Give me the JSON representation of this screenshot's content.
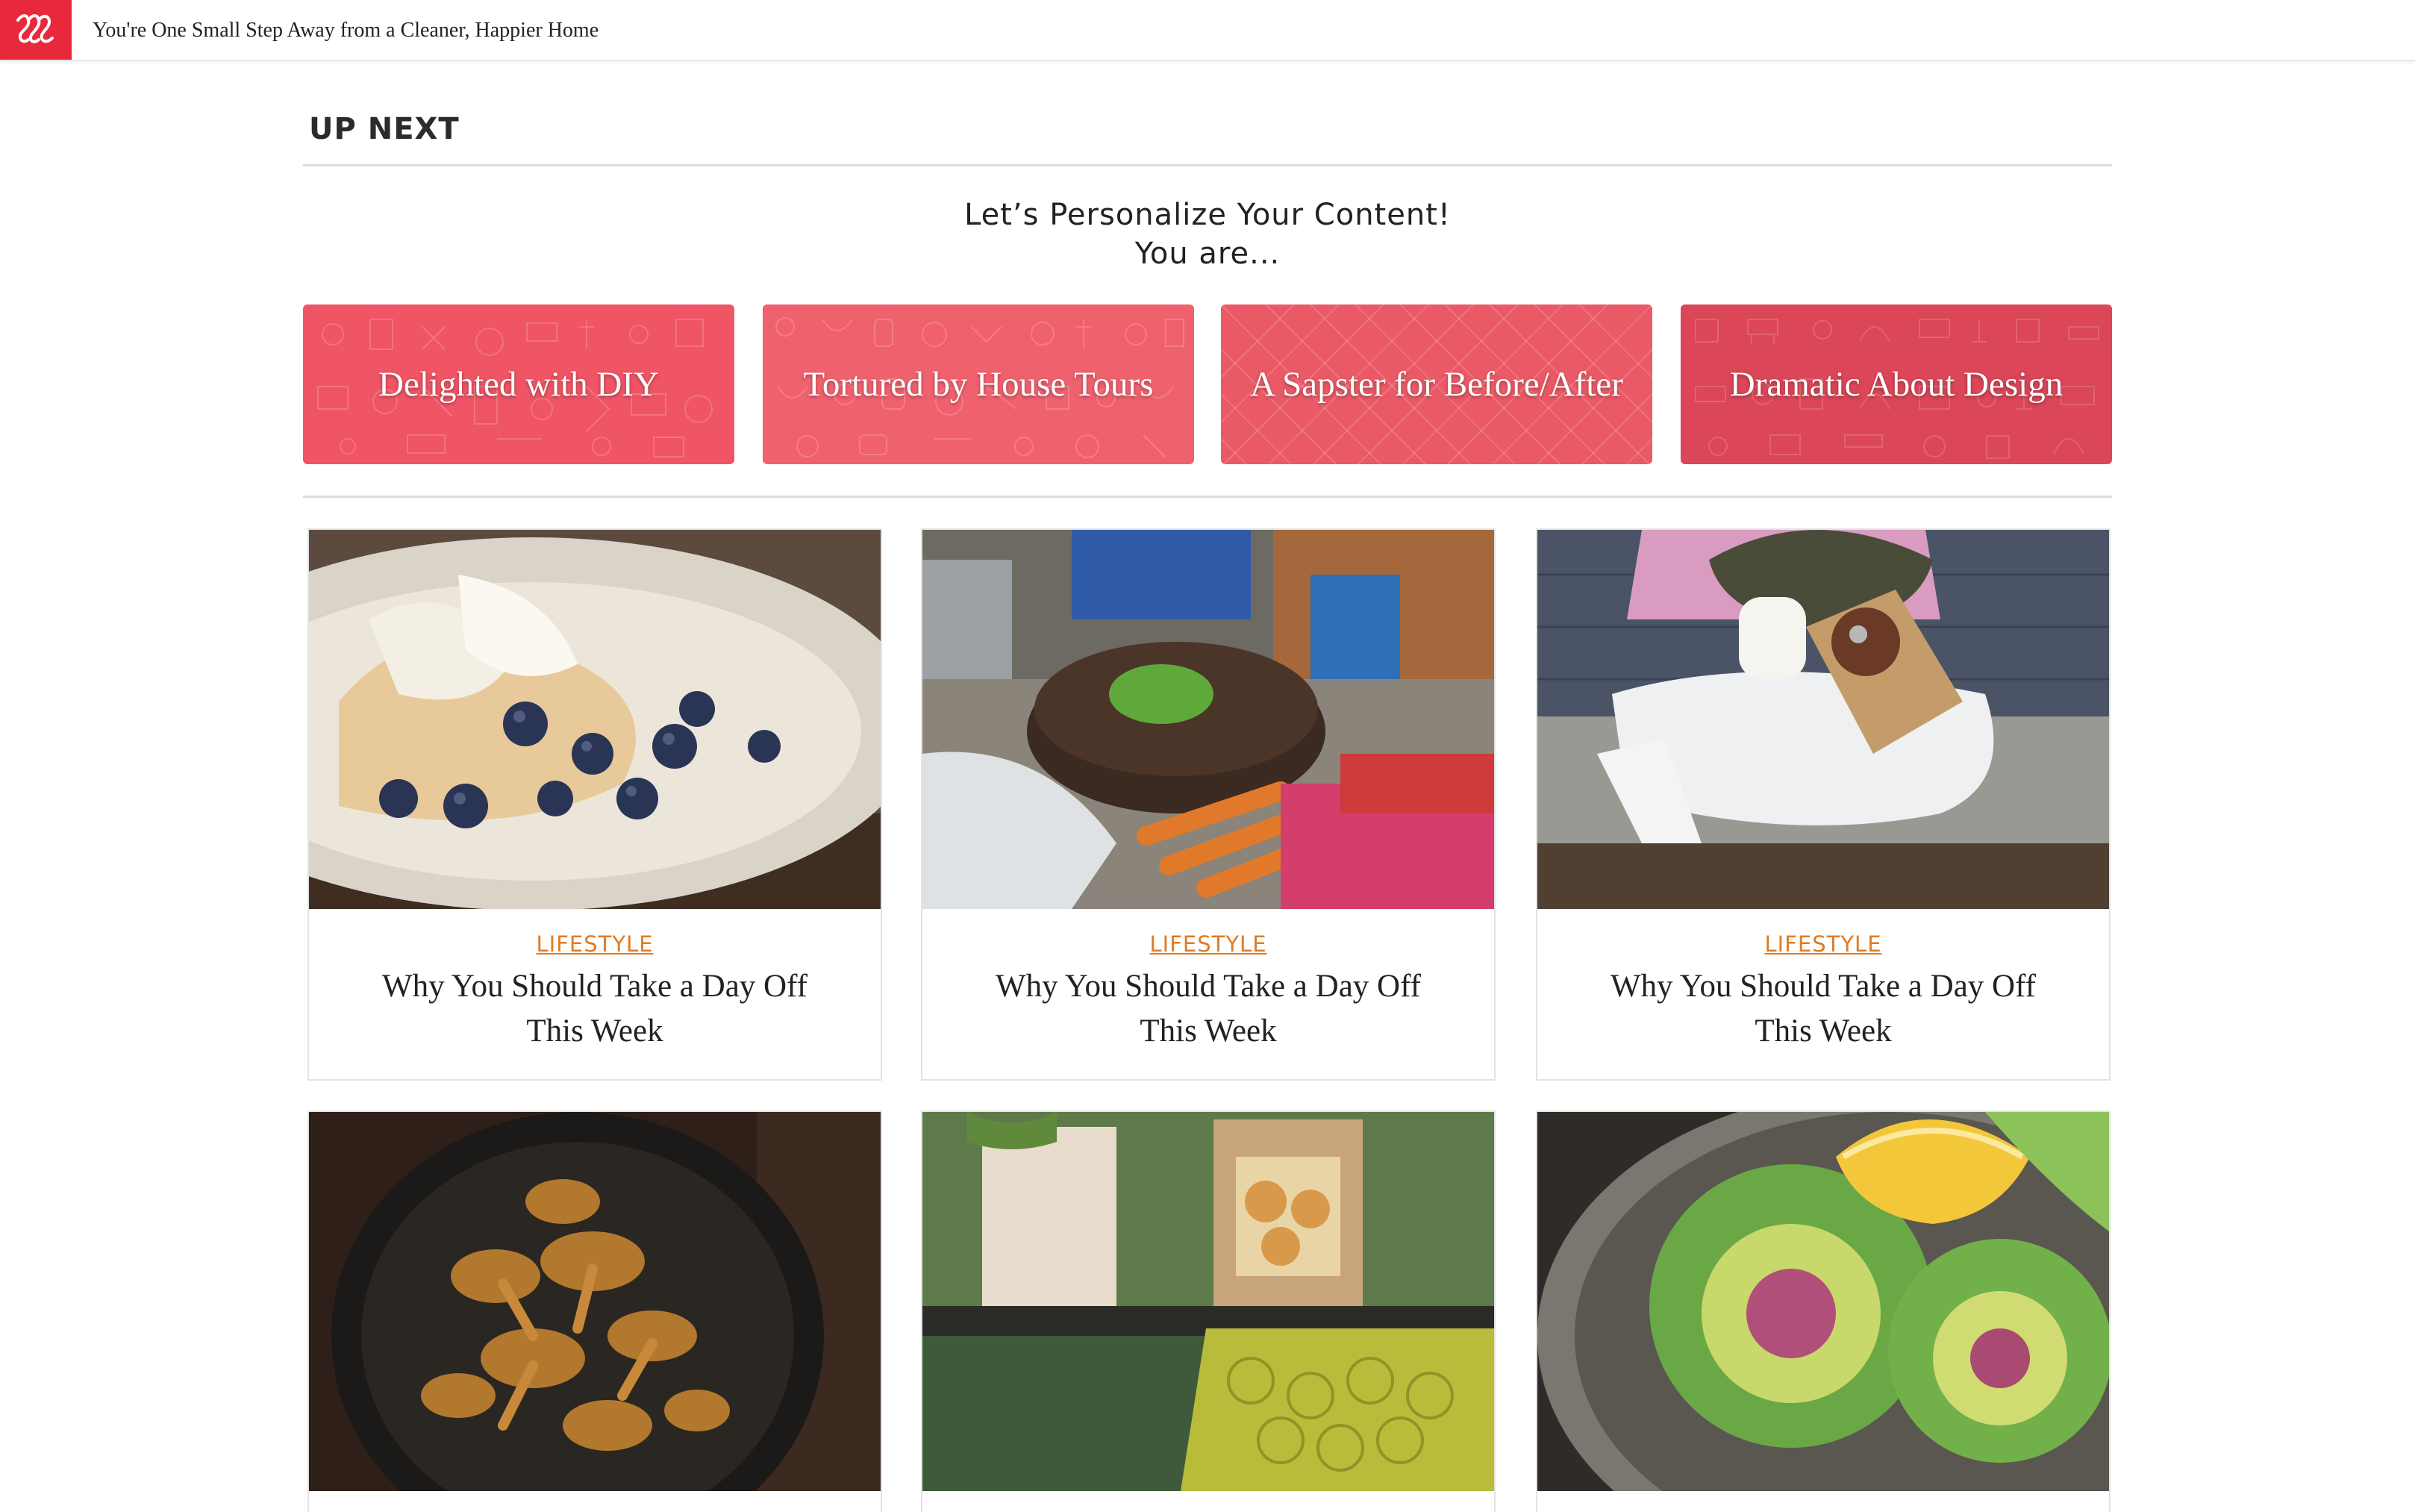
{
  "topbar": {
    "title": "You're One Small Step Away from a Cleaner, Happier Home",
    "brand_color": "#e8293c"
  },
  "section": {
    "title": "UP NEXT",
    "personalize_line1": "Let’s Personalize Your Content!",
    "personalize_line2": "You are..."
  },
  "personas": [
    {
      "label": "Delighted with DIY",
      "color": "#ef5565"
    },
    {
      "label": "Tortured by House Tours",
      "color": "#f0616e"
    },
    {
      "label": "A Sapster for Before/After",
      "color": "#ea5a66"
    },
    {
      "label": "Dramatic About Design",
      "color": "#db4658"
    }
  ],
  "cards": [
    {
      "category": "LIFESTYLE",
      "title": "Why You Should Take a Day Off This Week",
      "image": "crepes-blueberries-photo"
    },
    {
      "category": "LIFESTYLE",
      "title": "Why You Should Take a Day Off This Week",
      "image": "market-vegetables-photo"
    },
    {
      "category": "LIFESTYLE",
      "title": "Why You Should Take a Day Off This Week",
      "image": "coffee-pastry-sidewalk-photo"
    },
    {
      "image": "chanterelle-mushrooms-photo"
    },
    {
      "image": "pastry-box-lace-photo"
    },
    {
      "image": "artichokes-lemon-photo"
    }
  ],
  "colors": {
    "category": "#e07b24",
    "divider": "#dcdcdc"
  }
}
